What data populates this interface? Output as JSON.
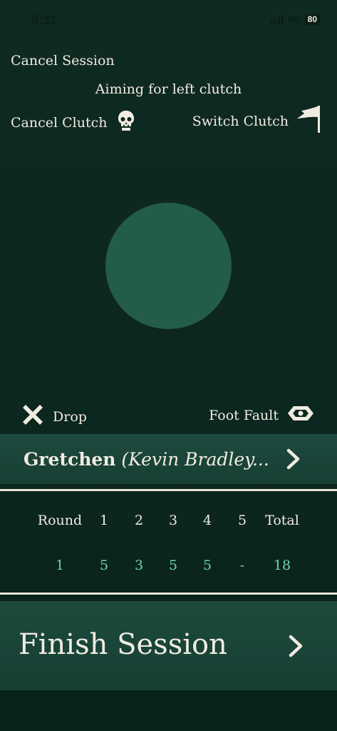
{
  "status": {
    "time": "9:31",
    "network": "5G",
    "battery": "80"
  },
  "header": {
    "cancel_session": "Cancel Session",
    "aim_text": "Aiming for left clutch",
    "cancel_clutch": "Cancel Clutch",
    "switch_clutch": "Switch Clutch"
  },
  "actions": {
    "drop": "Drop",
    "foot_fault": "Foot Fault"
  },
  "player": {
    "name": "Gretchen",
    "partner": "(Kevin Bradley..."
  },
  "scores": {
    "headers": [
      "Round",
      "1",
      "2",
      "3",
      "4",
      "5",
      "Total"
    ],
    "values": [
      "1",
      "5",
      "3",
      "5",
      "5",
      "-",
      "18"
    ]
  },
  "finish": {
    "label": "Finish Session"
  },
  "colors": {
    "background": "#0c2620",
    "accent": "#6fd3ae",
    "circle": "#245c4b",
    "bar": "#1e4a3e",
    "text": "#f1ece1"
  },
  "icons": {
    "cancel_clutch": "skull-icon",
    "switch_clutch": "flag-icon",
    "drop": "x-icon",
    "foot_fault": "eye-icon",
    "chevron": "chevron-right-icon"
  }
}
